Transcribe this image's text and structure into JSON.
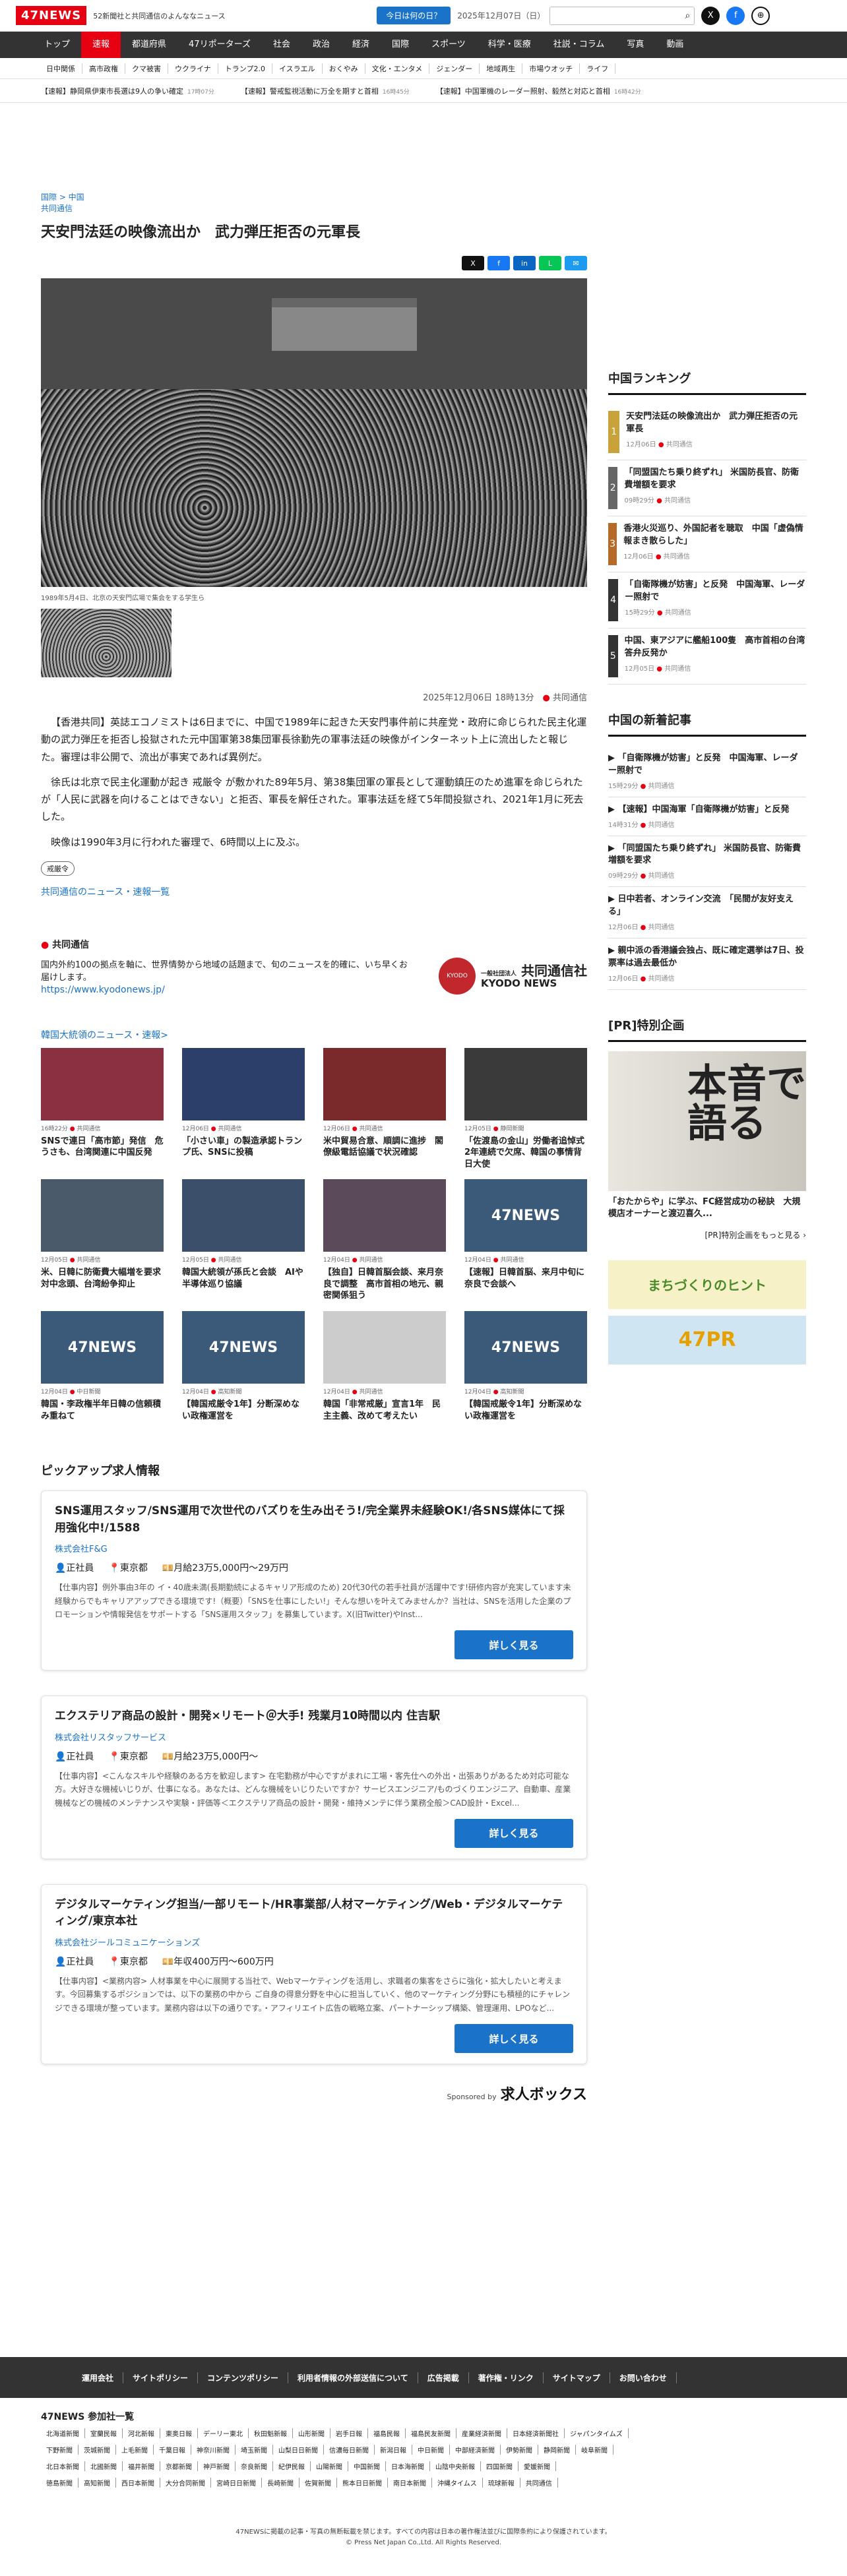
{
  "header": {
    "logo": "47NEWS",
    "tagline": "52新聞社と共同通信のよんななニュース",
    "today_btn": "今日は何の日？",
    "date": "2025年12月07日（日）",
    "search_icon": "magnifier",
    "x_icon": "X",
    "fb_icon": "f",
    "globe_icon": "⊕"
  },
  "nav": [
    "トップ",
    "速報",
    "都道府県",
    "47リポーターズ",
    "社会",
    "政治",
    "経済",
    "国際",
    "スポーツ",
    "科学・医療",
    "社説・コラム",
    "写真",
    "動画"
  ],
  "nav_active": "速報",
  "subnav": [
    "日中関係",
    "高市政権",
    "クマ被害",
    "ウクライナ",
    "トランプ2.0",
    "イスラエル",
    "おくやみ",
    "文化・エンタメ",
    "ジェンダー",
    "地域再生",
    "市場ウオッチ",
    "ライフ"
  ],
  "ticker": [
    {
      "text": "【速報】静岡県伊東市長選は9人の争い確定",
      "time": "17時07分"
    },
    {
      "text": "【速報】警戒監視活動に万全を期すと首相",
      "time": "16時45分"
    },
    {
      "text": "【速報】中国軍機のレーダー照射、毅然と対応と首相",
      "time": "16時42分"
    }
  ],
  "article": {
    "breadcrumb": "国際 > 中国",
    "source": "共同通信",
    "title": "天安門法廷の映像流出か　武力弾圧拒否の元軍長",
    "caption": "1989年5月4日、北京の天安門広場で集会をする学生ら",
    "datetime": "2025年12月06日 18時13分",
    "publisher": "共同通信",
    "paras": [
      "【香港共同】英誌エコノミストは6日までに、中国で1989年に起きた天安門事件前に共産党・政府に命じられた民主化運動の武力弾圧を拒否し投獄された元中国軍第38集団軍長徐勤先の軍事法廷の映像がインターネット上に流出したと報じた。審理は非公開で、流出が事実であれば異例だ。",
      "徐氏は北京で民主化運動が起き 戒厳令 が敷かれた89年5月、第38集団軍の軍長として運動鎮圧のため進軍を命じられたが「人民に武器を向けることはできない」と拒否、軍長を解任された。軍事法廷を経て5年間投獄され、2021年1月に死去した。",
      "映像は1990年3月に行われた審理で、6時間以上に及ぶ。"
    ],
    "keyword": "戒厳令",
    "more_link": "共同通信のニュース・速報一覧"
  },
  "kyodo": {
    "title": "共同通信",
    "desc": "国内外約100の拠点を軸に、世界情勢から地域の話題まで、旬のニュースを的確に、いち早くお届けします。",
    "url": "https://www.kyodonews.jp/",
    "seal": "KYODO",
    "name_jp": "共同通信社",
    "name_en": "KYODO NEWS",
    "prefix": "一般社団法人"
  },
  "related": {
    "title": "韓国大統領のニュース・速報>",
    "cards": [
      {
        "date": "16時22分",
        "src": "共同通信",
        "t": "SNSで連日「高市節」発信　危うさも、台湾関連に中国反発"
      },
      {
        "date": "12月06日",
        "src": "共同通信",
        "t": "「小さい車」の製造承認トランプ氏、SNSに投稿"
      },
      {
        "date": "12月06日",
        "src": "共同通信",
        "t": "米中貿易合意、順調に進捗　閣僚級電話協議で状況確認"
      },
      {
        "date": "12月05日",
        "src": "静岡新聞",
        "t": "「佐渡島の金山」労働者追悼式2年連続で欠席、韓国の事情背日大使"
      },
      {
        "date": "12月05日",
        "src": "共同通信",
        "t": "米、日韓に防衛費大幅増を要求　対中念頭、台湾紛争抑止"
      },
      {
        "date": "12月05日",
        "src": "共同通信",
        "t": "韓国大統領が孫氏と会談　AIや半導体巡り協議"
      },
      {
        "date": "12月04日",
        "src": "共同通信",
        "t": "【独自】日韓首脳会談、来月奈良で調整　高市首相の地元、親密関係狙う"
      },
      {
        "date": "12月04日",
        "src": "共同通信",
        "t": "【速報】日韓首脳、来月中旬に奈良で会談へ"
      },
      {
        "date": "12月04日",
        "src": "中日新聞",
        "t": "韓国・李政権半年日韓の信頼積み重ねて"
      },
      {
        "date": "12月04日",
        "src": "高知新聞",
        "t": "【韓国戒厳令1年】分断深めない政権運営を"
      },
      {
        "date": "12月04日",
        "src": "共同通信",
        "t": "韓国「非常戒厳」宣言1年　民主主義、改めて考えたい"
      },
      {
        "date": "12月04日",
        "src": "高知新聞",
        "t": "【韓国戒厳令1年】分断深めない政権運営を"
      }
    ]
  },
  "jobs": {
    "title": "ピックアップ求人情報",
    "items": [
      {
        "t": "SNS運用スタッフ/SNS運用で次世代のバズりを生み出そう!/完全業界未経験OK!/各SNS媒体にて採用強化中!/1588",
        "co": "株式会社F&G",
        "type": "正社員",
        "loc": "東京都",
        "pay": "月給23万5,000円〜29万円",
        "desc": "【仕事内容】例外事由3年の イ・40歳未満(長期勤続によるキャリア形成のため) 20代30代の若手社員が活躍中です!研修内容が充実しています未経験からでもキャリアアップできる環境です!（概要）「SNSを仕事にしたい!」そんな想いを叶えてみませんか？当社は、SNSを活用した企業のプロモーションや情報発信をサポートする「SNS運用スタッフ」を募集しています。X(旧Twitter)やInst..."
      },
      {
        "t": "エクステリア商品の設計・開発×リモート＠大手! 残業月10時間以内 住吉駅",
        "co": "株式会社リスタッフサービス",
        "type": "正社員",
        "loc": "東京都",
        "pay": "月給23万5,000円〜",
        "desc": "【仕事内容】<こんなスキルや経験のある方を歓迎します> 在宅勤務が中心ですがまれに工場・客先仕への外出・出張ありがあるため対応可能な方。大好きな機械いじりが、仕事になる。あなたは、どんな機械をいじりたいですか？サービスエンジニア/ものづくりエンジニア、自動車、産業機械などの機械のメンテナンスや実験・評価等＜エクステリア商品の設計・開発・維持メンテに伴う業務全般＞CAD設計・Excel..."
      },
      {
        "t": "デジタルマーケティング担当/一部リモート/HR事業部/人材マーケティング/Web・デジタルマーケティング/東京本社",
        "co": "株式会社ジールコミュニケーションズ",
        "type": "正社員",
        "loc": "東京都",
        "pay": "年収400万円〜600万円",
        "desc": "【仕事内容】<業務内容> 人材事業を中心に展開する当社で、Webマーケティングを活用し、求職者の集客をさらに強化・拡大したいと考えます。今回募集するポジションでは、以下の業務の中から ご自身の得意分野を中心に担当していく、他のマーケティング分野にも積極的にチャレンジできる環境が整っています。業務内容は以下の通りです。・アフィリエイト広告の戦略立案、パートナーシップ構築、管理運用、LPOなど..."
      }
    ],
    "btn": "詳しく見る",
    "sponsor": "Sponsored by",
    "sponsor_name": "求人ボックス"
  },
  "ranking": {
    "title": "中国ランキング",
    "items": [
      {
        "t": "天安門法廷の映像流出か　武力弾圧拒否の元軍長",
        "d": "12月06日",
        "src": "共同通信"
      },
      {
        "t": "「同盟国たち乗り終ずれ」 米国防長官、防衛費増額を要求",
        "d": "09時29分",
        "src": "共同通信"
      },
      {
        "t": "香港火災巡り、外国記者を聴取　中国「虚偽情報まき散らした」",
        "d": "12月06日",
        "src": "共同通信"
      },
      {
        "t": "「自衛隊機が妨害」と反発　中国海軍、レーダー照射で",
        "d": "15時29分",
        "src": "共同通信"
      },
      {
        "t": "中国、東アジアに艦船100隻　高市首相の台湾答弁反発か",
        "d": "12月05日",
        "src": "共同通信"
      }
    ],
    "colors": [
      "#c9a23a",
      "#666",
      "#b56a2a",
      "#333",
      "#333"
    ]
  },
  "newest": {
    "title": "中国の新着記事",
    "items": [
      {
        "t": "「自衛隊機が妨害」と反発　中国海軍、レーダー照射で",
        "d": "15時29分",
        "src": "共同通信"
      },
      {
        "t": "【速報】中国海軍「自衛隊機が妨害」と反発",
        "d": "14時31分",
        "src": "共同通信"
      },
      {
        "t": "「同盟国たち乗り終ずれ」 米国防長官、防衛費増額を要求",
        "d": "09時29分",
        "src": "共同通信"
      },
      {
        "t": "日中若者、オンライン交流　「民間が友好支える」",
        "d": "12月06日",
        "src": "共同通信"
      },
      {
        "t": "親中派の香港議会独占、既に確定選挙は7日、投票率は過去最低か",
        "d": "12月06日",
        "src": "共同通信"
      }
    ]
  },
  "pr": {
    "title": "[PR]特別企画",
    "big": "本音で語る",
    "cap": "「おたからや」に学ぶ、FC経営成功の秘訣　大規模店オーナーと渡辺喜久...",
    "more": "[PR]特別企画をもっと見る ›",
    "b1": "まちづくりのヒント",
    "b2": "47PR"
  },
  "footer": {
    "links": [
      "運用会社",
      "サイトポリシー",
      "コンテンツポリシー",
      "利用者情報の外部送信について",
      "広告掲載",
      "著作権・リンク",
      "サイトマップ",
      "お問い合わせ"
    ],
    "members_title": "47NEWS 参加社一覧",
    "rows": [
      [
        "北海道新聞",
        "室蘭民報",
        "河北新報",
        "東奥日報",
        "デーリー東北",
        "秋田魁新報",
        "山形新聞",
        "岩手日報",
        "福島民報",
        "福島民友新聞",
        "産業経済新聞",
        "日本経済新聞社",
        "ジャパンタイムズ"
      ],
      [
        "下野新聞",
        "茨城新聞",
        "上毛新聞",
        "千葉日報",
        "神奈川新聞",
        "埼玉新聞",
        "山梨日日新聞",
        "信濃毎日新聞",
        "新潟日報",
        "中日新聞",
        "中部経済新聞",
        "伊勢新聞",
        "静岡新聞",
        "岐阜新聞"
      ],
      [
        "北日本新聞",
        "北國新聞",
        "福井新聞",
        "京都新聞",
        "神戸新聞",
        "奈良新聞",
        "紀伊民報",
        "山陽新聞",
        "中国新聞",
        "日本海新聞",
        "山陰中央新報",
        "四国新聞",
        "愛媛新聞"
      ],
      [
        "徳島新聞",
        "高知新聞",
        "西日本新聞",
        "大分合同新聞",
        "宮崎日日新聞",
        "長崎新聞",
        "佐賀新聞",
        "熊本日日新聞",
        "南日本新聞",
        "沖縄タイムス",
        "琉球新報",
        "共同通信"
      ]
    ],
    "note": "47NEWSに掲載の記事・写真の無断転載を禁じます。すべての内容は日本の著作権法並びに国際条約により保護されています。",
    "copyright": "© Press Net Japan Co.,Ltd. All Rights Reserved."
  }
}
